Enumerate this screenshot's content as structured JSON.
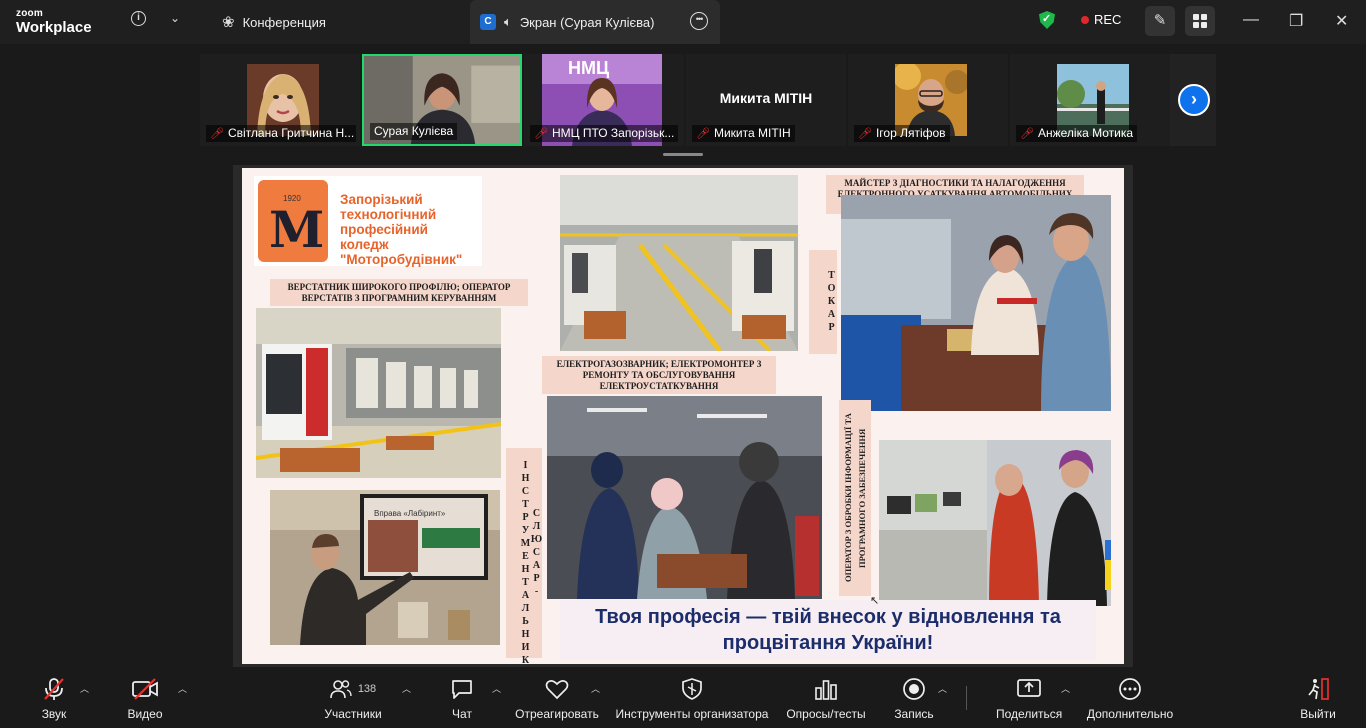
{
  "app": {
    "logo_line1": "zoom",
    "logo_line2": "Workplace"
  },
  "tabs": [
    {
      "label": "Конференция"
    },
    {
      "badge": "C",
      "label": "Экран (Сурая Кулієва)"
    }
  ],
  "status": {
    "rec": "REC"
  },
  "participants": [
    {
      "name": "Світлана Гритчина Н..."
    },
    {
      "name": "Сурая Кулієва"
    },
    {
      "name": "НМЦ ПТО Запорізьк..."
    },
    {
      "name": "Микита МІТІН",
      "display": "Микита МІТІН"
    },
    {
      "name": "Ігор Лятіфов"
    },
    {
      "name": "Анжеліка Мотика"
    }
  ],
  "slide": {
    "logo_year": "1920",
    "logo_letter": "M",
    "college_name": "Запорізький технологічний професійний коледж \"Моторобудівник\"",
    "label_machinist": "ВЕРСТАТНИК ШИРОКОГО ПРОФІЛЮ; ОПЕРАТОР ВЕРСТАТІВ З ПРОГРАМНИМ КЕРУВАННЯМ",
    "label_welder": "ЕЛЕКТРОГАЗОЗВАРНИК; ЕЛЕКТРОМОНТЕР З РЕМОНТУ ТА ОБСЛУГОВУВАННЯ ЕЛЕКТРОУСТАТКУВАННЯ",
    "label_master": "МАЙСТЕР З ДІАГНОСТИКИ ТА НАЛАГОДЖЕННЯ ЕЛЕКТРОННОГО УСАТКУВАННЯ АВТОМОБІЛЬНИХ ЗАСОБІВ",
    "label_turner": "ТОКАР",
    "label_fitter": "СЛЮСАР-ІНСТРУМЕНТАЛЬНИК",
    "label_operator": "ОПЕРАТОР З ОБРОБКИ ІНФОРМАЦІЇ ТА ПРОГРАМНОГО ЗАБЕЗПЕЧЕННЯ",
    "board_text": "Вправа «Лабіринт»",
    "slogan_line1": "Твоя професія — твій внесок у відновлення та",
    "slogan_line2": "процвітання України!"
  },
  "toolbar": {
    "audio": "Звук",
    "video": "Видео",
    "participants": "Участники",
    "participants_count": "138",
    "chat": "Чат",
    "react": "Отреагировать",
    "host_tools": "Инструменты организатора",
    "polls": "Опросы/тесты",
    "record": "Запись",
    "share": "Поделиться",
    "more": "Дополнительно",
    "leave": "Выйти"
  },
  "colors": {
    "accent": "#0e72ed",
    "active_speaker": "#23d96e",
    "rec": "#e02828",
    "college_orange": "#f07b3f"
  }
}
